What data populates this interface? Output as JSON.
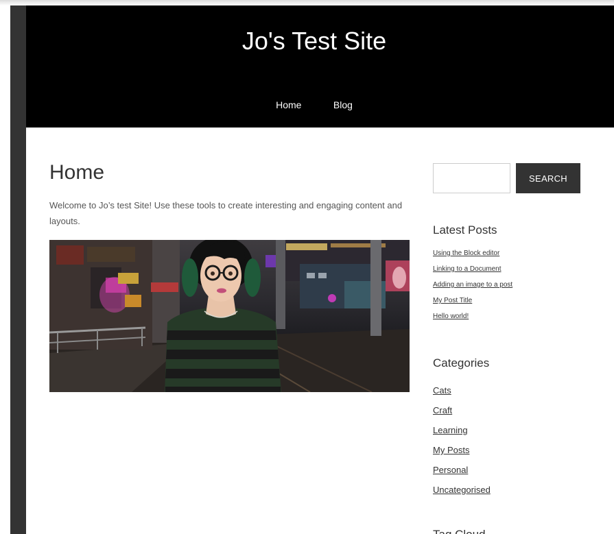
{
  "site": {
    "title": "Jo's Test Site"
  },
  "nav": {
    "items": [
      {
        "label": "Home"
      },
      {
        "label": "Blog"
      }
    ]
  },
  "page": {
    "title": "Home",
    "intro": "Welcome to Jo’s test Site! Use these tools to create interesting and engaging content and layouts."
  },
  "sidebar": {
    "search": {
      "button_label": "SEARCH",
      "placeholder": ""
    },
    "latest_posts": {
      "title": "Latest Posts",
      "items": [
        "Using the Block editor",
        "Linking to a Document",
        "Adding an image to a post",
        "My Post Title",
        "Hello world!"
      ]
    },
    "categories": {
      "title": "Categories",
      "items": [
        "Cats",
        "Craft",
        "Learning",
        "My Posts",
        "Personal",
        "Uncategorised"
      ]
    },
    "tag_cloud": {
      "title": "Tag Cloud"
    }
  },
  "colors": {
    "header_bg": "#000000",
    "frame": "#333333",
    "button_bg": "#333333",
    "text": "#333333"
  }
}
